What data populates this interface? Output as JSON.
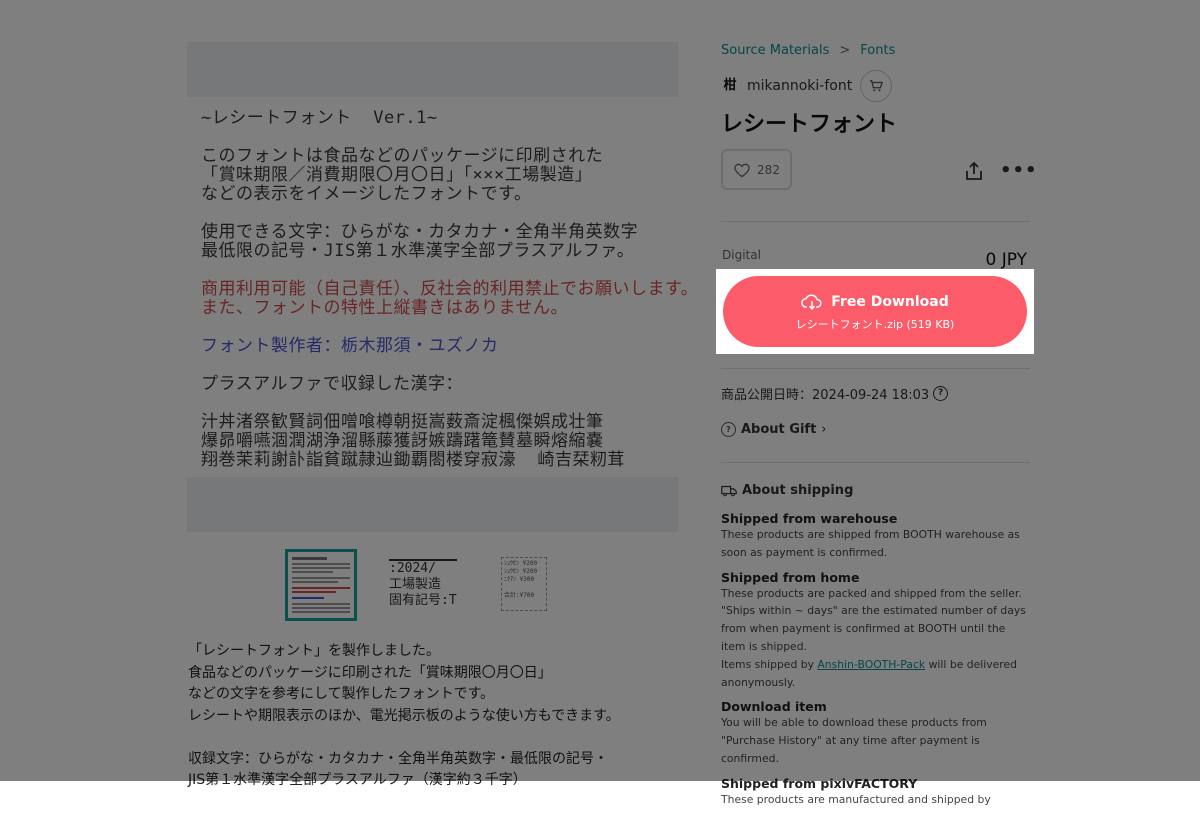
{
  "breadcrumb": {
    "item1": "Source Materials",
    "sep": ">",
    "item2": "Fonts"
  },
  "shop": {
    "name": "mikannoki-font",
    "logo_text": "柑",
    "cart_icon": "cart-icon"
  },
  "product": {
    "title": "レシートフォント",
    "likes": "282",
    "type_label": "Digital",
    "price": "0 JPY",
    "download_label": "Free Download",
    "download_file": "レシートフォント.zip (519 KB)",
    "published": "商品公開日時：2024-09-24 18:03",
    "about_gift": "About Gift"
  },
  "receipt": {
    "l1": "~レシートフォント  Ver.1~",
    "l2": "このフォントは食品などのパッケージに印刷された\n「賞味期限／消費期限〇月〇日」「×××工場製造」\nなどの表示をイメージしたフォントです。",
    "l3": "使用できる文字：ひらがな・カタカナ・全角半角英数字\n最低限の記号・JIS第１水準漢字全部プラスアルファ。",
    "l4": "商用利用可能（自己責任）、反社会的利用禁止でお願いします。\nまた、フォントの特性上縦書きはありません。",
    "l5": "フォント製作者：栃木那須・ユズノカ",
    "l6": "プラスアルファで収録した漢字：",
    "l7": "汁丼渚祭歓賢詞佃噌喰樽朝挺嵩薮斎淀楓傑娯成壮筆\n爆昴嚼嚥涸潤湖浄溜縣藤獲訝嫉躊躇篭賛墓瞬熔縮嚢\n翔巻茉莉謝訃詣貧蹴隷辿鋤覇閤楼穿寂濠  崎吉栞籾茸"
  },
  "thumbs": {
    "t2_text": ":2024/\n工場製造\n固有記号:T",
    "t3_text": "ｼｮｳｾﾝ ¥200\nｼｮｳｾﾝ ¥200\nﾆｸﾏﾝ ¥300\n\n合計:¥700"
  },
  "description": {
    "line1": "「レシートフォント」を製作しました。",
    "line2": "食品などのパッケージに印刷された「賞味期限〇月〇日」",
    "line3": "などの文字を参考にして製作したフォントです。",
    "line4": "レシートや期限表示のほか、電光掲示板のような使い方もできます。",
    "line5": "収録文字：ひらがな・カタカナ・全角半角英数字・最低限の記号・",
    "line6": "JIS第１水準漢字全部プラスアルファ（漢字約３千字）"
  },
  "shipping": {
    "heading": "About shipping",
    "warehouse_h": "Shipped from warehouse",
    "warehouse_b": "These products are shipped from BOOTH warehouse as soon as payment is confirmed.",
    "home_h": "Shipped from home",
    "home_b1": "These products are packed and shipped from the seller. \"Ships within ~ days\" are the estimated number of days from when payment is confirmed at BOOTH until the item is shipped.",
    "home_b2_pre": "Items shipped by ",
    "home_b2_link": "Anshin-BOOTH-Pack",
    "home_b2_post": " will be delivered anonymously.",
    "download_h": "Download item",
    "download_b": "You will be able to download these products from \"Purchase History\" at any time after payment is confirmed.",
    "factory_h": "Shipped from pixivFACTORY",
    "factory_b": "These products are manufactured and shipped by"
  },
  "colors": {
    "accent": "#fc5c6a",
    "link": "#0a8c93",
    "thumb_border": "#12a39a"
  }
}
